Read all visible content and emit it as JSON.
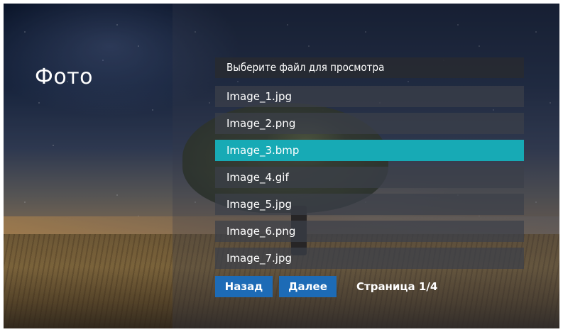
{
  "page": {
    "title": "Фото"
  },
  "file_list": {
    "header": "Выберите файл для просмотра",
    "items": [
      {
        "label": "Image_1.jpg"
      },
      {
        "label": "Image_2.png"
      },
      {
        "label": "Image_3.bmp"
      },
      {
        "label": "Image_4.gif"
      },
      {
        "label": "Image_5.jpg"
      },
      {
        "label": "Image_6.png"
      },
      {
        "label": "Image_7.jpg"
      }
    ],
    "selected_index": 2
  },
  "navigation": {
    "back_label": "Назад",
    "next_label": "Далее",
    "page_indicator": "Страница 1/4"
  },
  "colors": {
    "selected_row": "#17aab5",
    "button": "#1d6bb6",
    "text": "#ffffff"
  },
  "background": {
    "scene": "night-sky-tree-field-photo"
  }
}
